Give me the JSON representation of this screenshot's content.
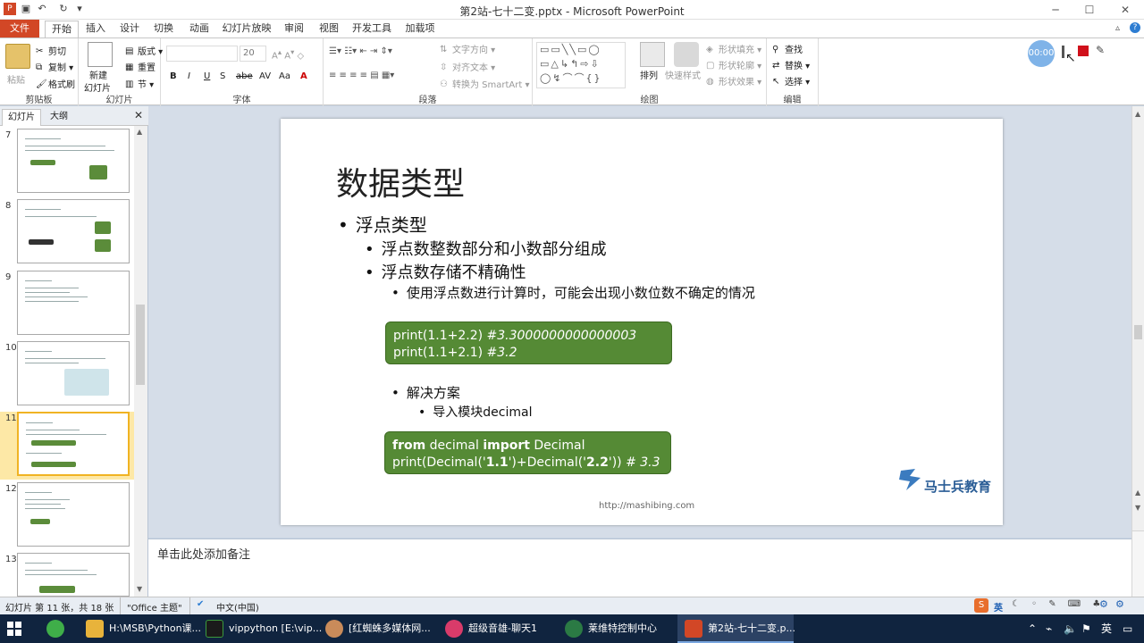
{
  "window": {
    "title": "第2站-七十二变.pptx - Microsoft PowerPoint"
  },
  "menu": {
    "tabs": [
      "文件",
      "开始",
      "插入",
      "设计",
      "切换",
      "动画",
      "幻灯片放映",
      "审阅",
      "视图",
      "开发工具",
      "加载项"
    ],
    "active": "开始"
  },
  "ribbon": {
    "clipboard": {
      "paste": "粘贴",
      "cut": "剪切",
      "copy": "复制",
      "format_painter": "格式刷",
      "label": "剪贴板"
    },
    "slides": {
      "new_slide_l1": "新建",
      "new_slide_l2": "幻灯片",
      "layout": "版式",
      "reset": "重置",
      "section": "节",
      "label": "幻灯片"
    },
    "font": {
      "size": "20",
      "label": "字体"
    },
    "paragraph": {
      "text_direction": "文字方向",
      "align_text": "对齐文本",
      "smartart": "转换为 SmartArt",
      "label": "段落"
    },
    "drawing": {
      "arrange": "排列",
      "quick_styles": "快速样式",
      "shape_fill": "形状填充",
      "shape_outline": "形状轮廓",
      "shape_effects": "形状效果",
      "label": "绘图"
    },
    "editing": {
      "find": "查找",
      "replace": "替换",
      "select": "选择",
      "label": "编辑"
    }
  },
  "recording": {
    "timer": "00:00"
  },
  "panel": {
    "tab_slides": "幻灯片",
    "tab_outline": "大纲",
    "slide_numbers": [
      "7",
      "8",
      "9",
      "10",
      "11",
      "12",
      "13"
    ],
    "selected": "11"
  },
  "slide": {
    "title": "数据类型",
    "bullet1": "浮点类型",
    "bullet1_1": "浮点数整数部分和小数部分组成",
    "bullet1_2": "浮点数存储不精确性",
    "bullet1_2_1": "使用浮点数进行计算时，可能会出现小数位数不确定的情况",
    "code1_line1_code": "print(1.1+2.2)",
    "code1_line1_comment": "#3.3000000000000003",
    "code1_line2_code": "print(1.1+2.1)",
    "code1_line2_comment": "#3.2",
    "bullet2": "解决方案",
    "bullet2_1": "导入模块decimal",
    "code2_from": "from",
    "code2_module": "decimal",
    "code2_import": "import",
    "code2_class": "Decimal",
    "code2_l2_a": "print(Decimal('",
    "code2_l2_b": "1.1",
    "code2_l2_c": "')+Decimal('",
    "code2_l2_d": "2.2",
    "code2_l2_e": "'))",
    "code2_comment": "# 3.3",
    "logo_text": "马士兵教育",
    "url": "http://mashibing.com"
  },
  "notes": {
    "placeholder": "单击此处添加备注"
  },
  "status": {
    "slide_info": "幻灯片 第 11 张，共 18 张",
    "theme": "\"Office 主题\"",
    "language": "中文(中国)",
    "ime": "英"
  },
  "taskbar": {
    "items": [
      "H:\\MSB\\Python课...",
      "vippython [E:\\vip...",
      "[红蜘蛛多媒体网...",
      "超级音雄-聊天1",
      "莱维特控制中心",
      "第2站-七十二变.p..."
    ],
    "tray_ime": "英"
  },
  "colors": {
    "accent_file": "#d24726",
    "code_bg": "#558a35",
    "taskbar": "#10243f"
  }
}
